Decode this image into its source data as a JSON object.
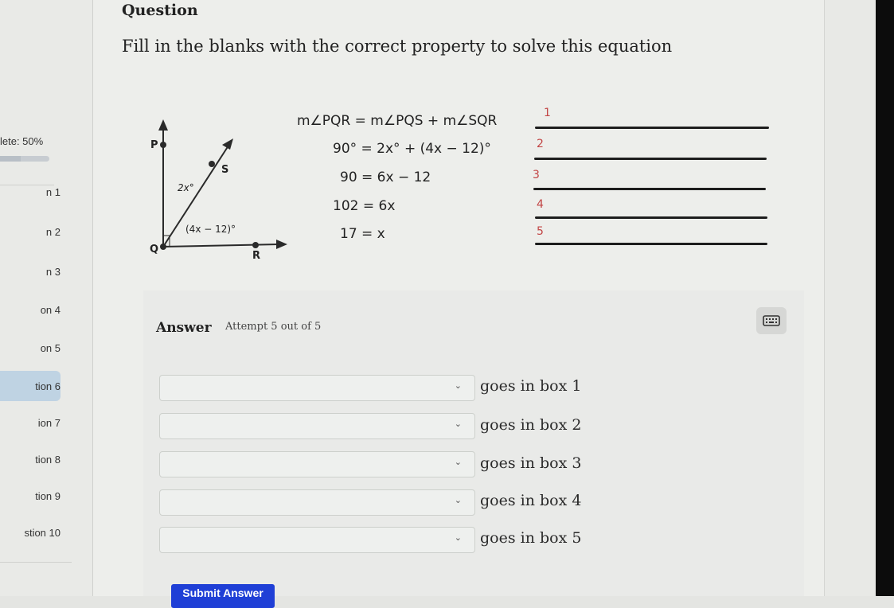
{
  "sidebar": {
    "progress_label": "lete: 50%",
    "progress_fraction": 0.5,
    "items": [
      {
        "label": "n 1",
        "active": false
      },
      {
        "label": "n 2",
        "active": false
      },
      {
        "label": "n 3",
        "active": false
      },
      {
        "label": "on 4",
        "active": false
      },
      {
        "label": "on 5",
        "active": false
      },
      {
        "label": "tion 6",
        "active": true
      },
      {
        "label": "ion 7",
        "active": false
      },
      {
        "label": "tion 8",
        "active": false
      },
      {
        "label": "tion 9",
        "active": false
      },
      {
        "label": "stion 10",
        "active": false
      }
    ]
  },
  "question": {
    "heading": "Question",
    "prompt": "Fill in the blanks with the correct property to solve this equation"
  },
  "figure": {
    "points": {
      "P": "P",
      "S": "S",
      "Q": "Q",
      "R": "R"
    },
    "angle_labels": {
      "upper": "2x°",
      "lower": "(4x − 12)°"
    }
  },
  "equations": [
    "m∠PQR = m∠PQS + m∠SQR",
    "90° = 2x° + (4x − 12)°",
    "90 = 6x − 12",
    "102 = 6x",
    "17 = x"
  ],
  "blanks": [
    "1",
    "2",
    "3",
    "4",
    "5"
  ],
  "answer": {
    "label": "Answer",
    "attempt": "Attempt 5 out of 5",
    "keyboard_icon": "keyboard-icon",
    "rows": [
      {
        "selected": "",
        "label": "goes in box 1"
      },
      {
        "selected": "",
        "label": "goes in box 2"
      },
      {
        "selected": "",
        "label": "goes in box 3"
      },
      {
        "selected": "",
        "label": "goes in box 4"
      },
      {
        "selected": "",
        "label": "goes in box 5"
      }
    ],
    "chevron": "⌄",
    "submit_label": "Submit Answer"
  },
  "colors": {
    "blank_number": "#c24545",
    "submit": "#1f3fd6",
    "active_nav": "#bfd3e3"
  }
}
